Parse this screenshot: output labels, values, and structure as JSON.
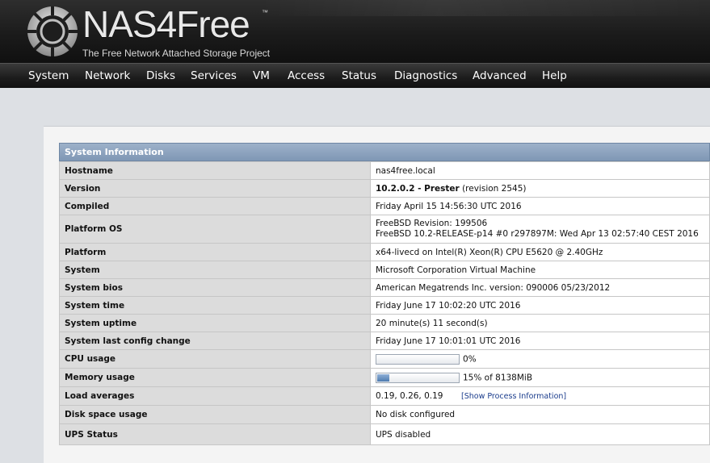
{
  "brand": {
    "name": "NAS4Free",
    "trademark": "™",
    "tagline": "The Free Network Attached Storage Project"
  },
  "nav": [
    "System",
    "Network",
    "Disks",
    "Services",
    "VM",
    "Access",
    "Status",
    "Diagnostics",
    "Advanced",
    "Help"
  ],
  "sysinfo": {
    "title": "System Information",
    "labels": {
      "hostname": "Hostname",
      "version": "Version",
      "compiled": "Compiled",
      "platform_os": "Platform OS",
      "platform": "Platform",
      "system": "System",
      "system_bios": "System bios",
      "system_time": "System time",
      "system_uptime": "System uptime",
      "last_config_change": "System last config change",
      "cpu_usage": "CPU usage",
      "memory_usage": "Memory usage",
      "load_averages": "Load averages",
      "disk_space_usage": "Disk space usage",
      "ups_status": "UPS Status"
    },
    "values": {
      "hostname": "nas4free.local",
      "version_number": "10.2.0.2 - Prester",
      "version_revision": "(revision 2545)",
      "compiled": "Friday April 15 14:56:30 UTC 2016",
      "platform_os_line1": "FreeBSD Revision: 199506",
      "platform_os_line2": "FreeBSD 10.2-RELEASE-p14 #0 r297897M: Wed Apr 13 02:57:40 CEST 2016",
      "platform": "x64-livecd on Intel(R) Xeon(R) CPU E5620 @ 2.40GHz",
      "system": "Microsoft Corporation Virtual Machine",
      "system_bios": "American Megatrends Inc. version: 090006 05/23/2012",
      "system_time": "Friday June 17 10:02:20 UTC 2016",
      "system_uptime": "20 minute(s) 11 second(s)",
      "last_config_change": "Friday June 17 10:01:01 UTC 2016",
      "cpu_usage_text": "0%",
      "cpu_usage_fraction": 0.0,
      "memory_usage_text": "15% of 8138MiB",
      "memory_usage_fraction": 0.15,
      "load_averages": "0.19, 0.26, 0.19",
      "show_process_link": "[Show Process Information]",
      "disk_space_usage": "No disk configured",
      "ups_status": "UPS disabled"
    }
  },
  "colors": {
    "title_bar": "#8aa0bd",
    "label_bg": "#dcdcdc",
    "progress_fill": "#5f8ac0"
  }
}
